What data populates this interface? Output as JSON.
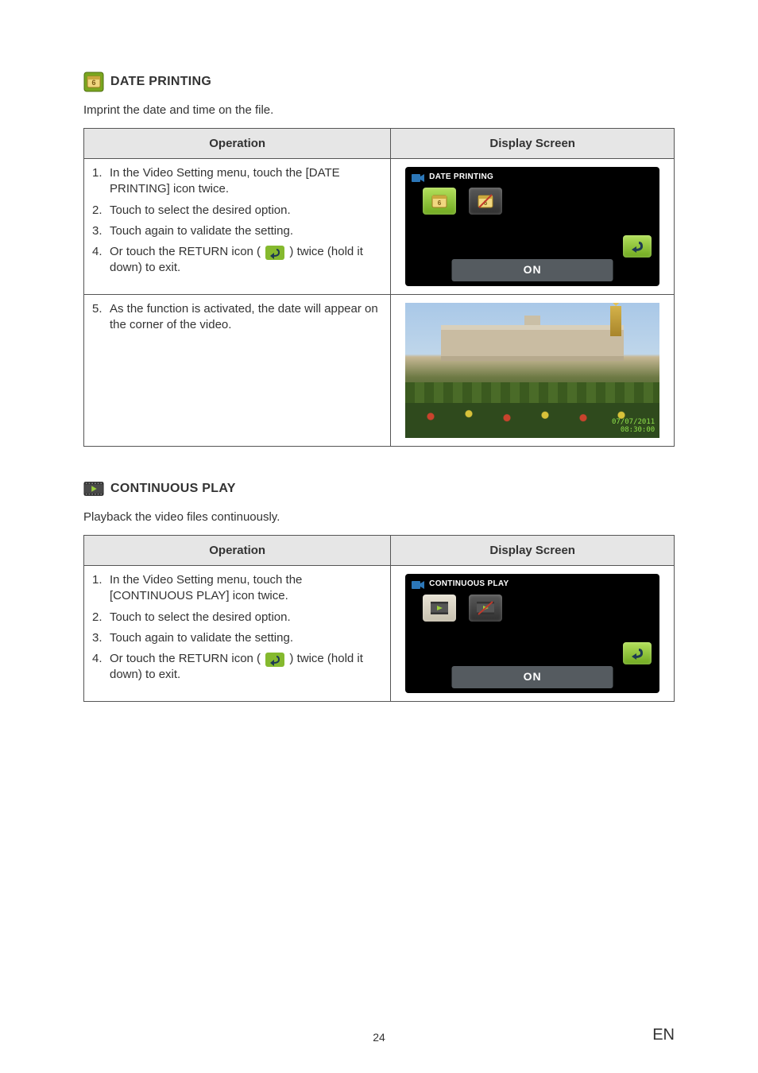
{
  "section1": {
    "heading": "DATE PRINTING",
    "intro": "Imprint the date and time on the file.",
    "col_operation": "Operation",
    "col_display": "Display Screen",
    "steps_a": [
      "In the Video Setting menu, touch the [DATE PRINTING] icon twice.",
      "Touch to select the desired option.",
      "Touch again to validate the setting.",
      "Or touch the RETURN icon (",
      ") twice (hold it down) to exit."
    ],
    "step_nums_a": [
      "1.",
      "2.",
      "3.",
      "4."
    ],
    "steps_b_num": "5.",
    "steps_b": "As the function is activated, the date will appear on the corner of the video.",
    "mock_title": "DATE PRINTING",
    "pill_label": "ON",
    "date_line1": "07/07/2011",
    "date_line2": "08:30:00"
  },
  "section2": {
    "heading": "CONTINUOUS PLAY",
    "intro": "Playback the video files continuously.",
    "col_operation": "Operation",
    "col_display": "Display Screen",
    "steps": [
      "In the Video Setting menu, touch the [CONTINUOUS PLAY] icon twice.",
      "Touch to select the desired option.",
      "Touch again to validate the setting.",
      "Or touch the RETURN icon (",
      ") twice (hold it down) to exit."
    ],
    "step_nums": [
      "1.",
      "2.",
      "3.",
      "4."
    ],
    "mock_title": "CONTINUOUS PLAY",
    "pill_label": "ON"
  },
  "footer": {
    "page": "24",
    "lang": "EN"
  }
}
